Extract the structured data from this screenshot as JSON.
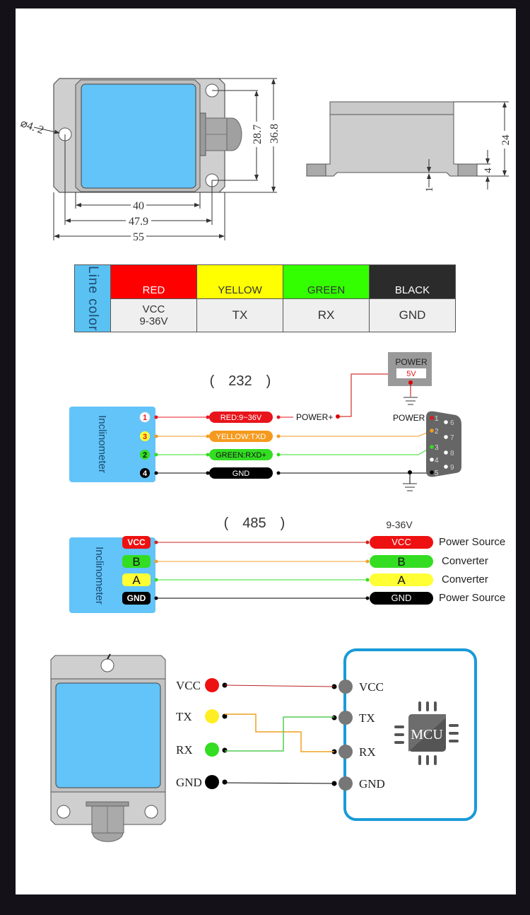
{
  "dimensions_top_view": {
    "hole_diameter": "⌀4. 2",
    "width_inner": "40",
    "hole_spacing_x": "47.9",
    "width_total": "55",
    "hole_spacing_y": "28.7",
    "height_total": "36.8"
  },
  "dimensions_side_view": {
    "height_total": "24",
    "flange_height": "4",
    "base_offset": "1"
  },
  "line_color_table": {
    "header": "Line color",
    "columns": [
      {
        "color_name": "RED",
        "color": "#ff0000",
        "text_color": "#ffffff",
        "signal": "VCC\n9-36V",
        "signal_line1": "VCC",
        "signal_line2": "9-36V"
      },
      {
        "color_name": "YELLOW",
        "color": "#ffff00",
        "text_color": "#333333",
        "signal": "TX"
      },
      {
        "color_name": "GREEN",
        "color": "#33ff00",
        "text_color": "#333333",
        "signal": "RX"
      },
      {
        "color_name": "BLACK",
        "color": "#2b2b2b",
        "text_color": "#ffffff",
        "signal": "GND"
      }
    ]
  },
  "rs232": {
    "title": "(　232　)",
    "device_label": "Inclinometer",
    "pins": [
      {
        "num": "1",
        "wire_label": "RED:9~36V",
        "color": "#e8141c",
        "num_bg": "#ffffff",
        "num_color": "#e8141c"
      },
      {
        "num": "3",
        "wire_label": "YELLOW:TXD",
        "color": "#f59a1e",
        "num_bg": "#ffff33",
        "num_color": "#e8141c"
      },
      {
        "num": "2",
        "wire_label": "GREEN:RXD+",
        "color": "#33dd22",
        "num_bg": "#33dd22",
        "num_color": "#111111"
      },
      {
        "num": "4",
        "wire_label": "GND",
        "color": "#000000",
        "num_bg": "#000000",
        "num_color": "#ffffff"
      }
    ],
    "power_plus_label": "POWER+",
    "power_box_title": "POWER",
    "power_box_value": "5V",
    "db9_label": "POWER",
    "db9_pins_left": [
      "1",
      "2",
      "3",
      "4",
      "5"
    ],
    "db9_pins_right": [
      "6",
      "7",
      "8",
      "9"
    ]
  },
  "rs485": {
    "title": "(　485　)",
    "device_label": "Inclinometer",
    "supply_label": "9-36V",
    "pins": [
      {
        "label": "VCC",
        "color": "#ee1111",
        "text_color": "#ffffff",
        "wire": "#cc2222",
        "target": "Power Source"
      },
      {
        "label": "B",
        "color": "#33dd22",
        "text_color": "#111111",
        "wire": "#f0a030",
        "target": "Converter"
      },
      {
        "label": "A",
        "color": "#ffff33",
        "text_color": "#111111",
        "wire": "#33dd22",
        "target": "Converter"
      },
      {
        "label": "GND",
        "color": "#000000",
        "text_color": "#ffffff",
        "wire": "#000000",
        "target": "Power Source"
      }
    ]
  },
  "mcu_wiring": {
    "sensor_pins": [
      {
        "label": "VCC",
        "color": "#ee1111"
      },
      {
        "label": "TX",
        "color": "#ffee22"
      },
      {
        "label": "RX",
        "color": "#33dd22"
      },
      {
        "label": "GND",
        "color": "#000000"
      }
    ],
    "mcu_pins": [
      "VCC",
      "TX",
      "RX",
      "GND"
    ],
    "mcu_label": "MCU",
    "border_color": "#1a9ad8"
  }
}
